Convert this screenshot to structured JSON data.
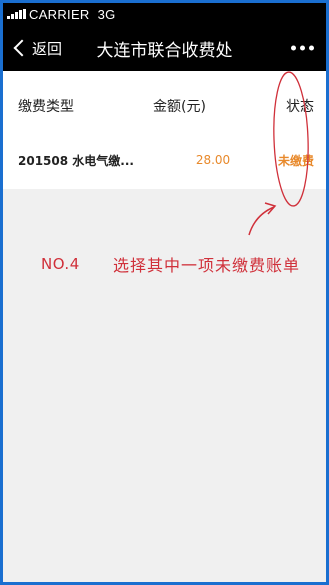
{
  "status_bar": {
    "carrier": "CARRIER",
    "network": "3G"
  },
  "nav": {
    "back_label": "返回",
    "title": "大连市联合收费处"
  },
  "table": {
    "headers": {
      "type": "缴费类型",
      "amount": "金额(元)",
      "status": "状态"
    },
    "rows": [
      {
        "type": "201508 水电气缴...",
        "amount": "28.00",
        "status": "未缴费"
      }
    ]
  },
  "annotation": {
    "step": "NO.4",
    "text": "选择其中一项未缴费账单"
  },
  "colors": {
    "accent": "#e8892b",
    "annotation": "#d0303a",
    "frame": "#1a6fd0"
  },
  "icons": [
    "signal-icon",
    "back-chevron-icon",
    "more-icon"
  ]
}
